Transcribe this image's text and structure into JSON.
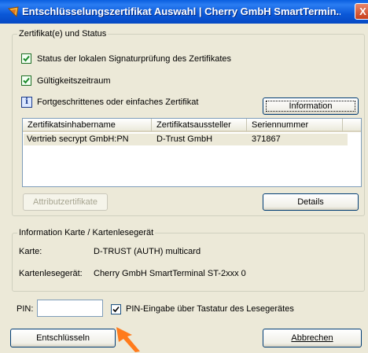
{
  "window": {
    "title": "Entschlüsselungszertifikat Auswahl | Cherry GmbH SmartTermin...",
    "close": "X"
  },
  "status_group": {
    "label": "Zertifikat(e) und Status",
    "checks": [
      "Status der lokalen Signaturprüfung des Zertifikates",
      "Gültigkeitszeitraum"
    ],
    "info_text": "Fortgeschrittenes oder einfaches Zertifikat",
    "info_glyph": "i",
    "information_button": "Information",
    "table": {
      "columns": [
        "Zertifikatsinhabername",
        "Zertifikatsaussteller",
        "Seriennummer"
      ],
      "rows": [
        {
          "holder": "Vertrieb secrypt GmbH:PN",
          "issuer": "D-Trust GmbH",
          "serial": "371867"
        }
      ]
    },
    "attribute_button": "Attributzertifikate",
    "details_button": "Details"
  },
  "card_group": {
    "label": "Information Karte / Kartenlesegerät",
    "card_label": "Karte:",
    "card_value": "D-TRUST (AUTH) multicard",
    "reader_label": "Kartenlesegerät:",
    "reader_value": "Cherry GmbH SmartTerminal ST-2xxx 0"
  },
  "pin": {
    "label": "PIN:",
    "value": "",
    "keyboard_checkbox_label": "PIN-Eingabe über Tastatur des Lesegerätes",
    "keyboard_checked": true
  },
  "actions": {
    "decrypt": "Entschlüsseln",
    "cancel": "Abbrechen"
  },
  "colors": {
    "titlebar": "#0a5fe0",
    "check_green": "#1c6e24",
    "arrow_orange": "#ff7b1c"
  }
}
